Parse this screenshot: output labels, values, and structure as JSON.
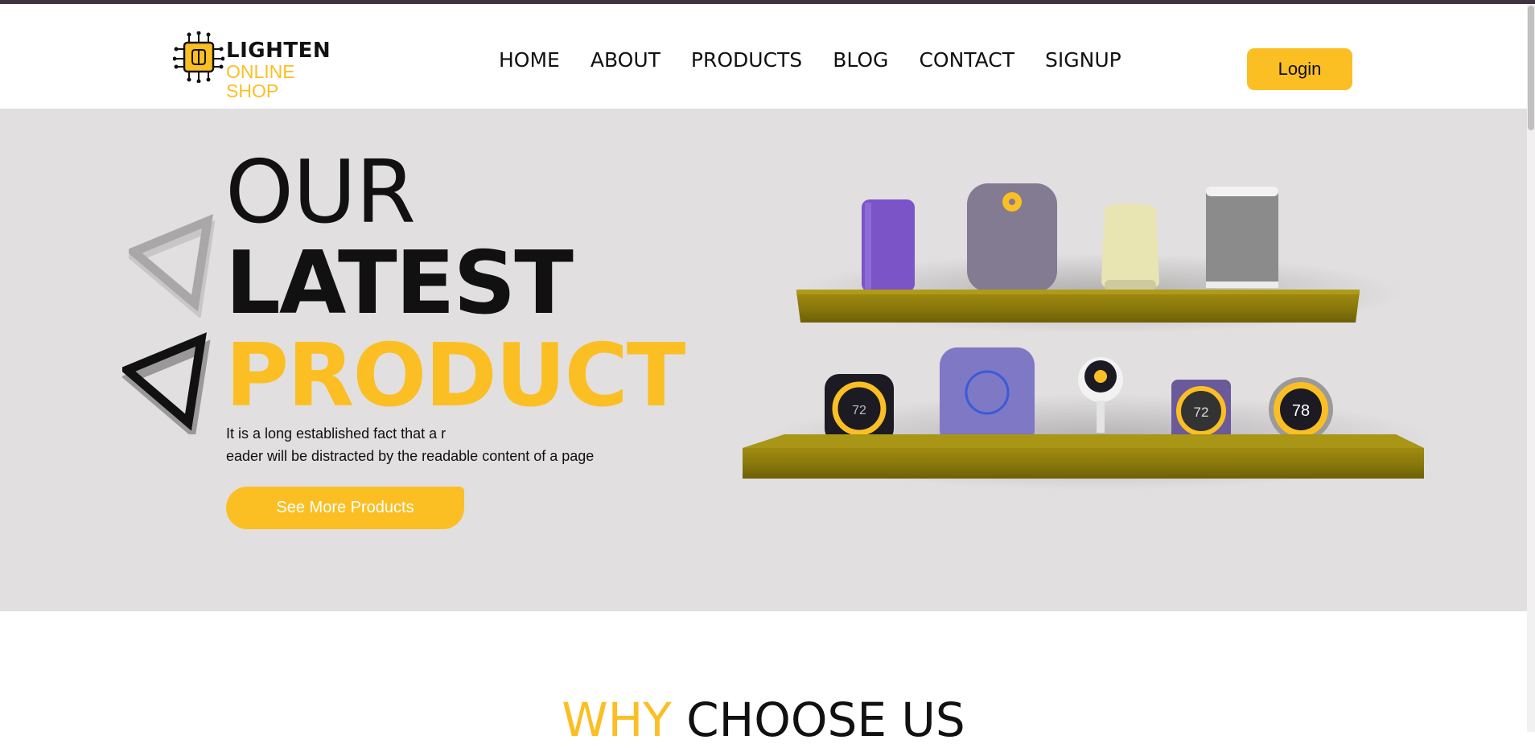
{
  "brand": {
    "title": "LIGHTEN",
    "subtitle": "ONLINE SHOP"
  },
  "nav": {
    "items": [
      "HOME",
      "ABOUT",
      "PRODUCTS",
      "BLOG",
      "CONTACT",
      "SIGNUP"
    ]
  },
  "header": {
    "login_label": "Login"
  },
  "hero": {
    "line1": "OUR",
    "line2": "LATEST",
    "line3": "PRODUCT",
    "text_line1": "It is a long established fact that a r",
    "text_line2": "eader will be distracted by the readable content of a page",
    "cta_label": "See More Products",
    "device_readouts": [
      "72",
      "72",
      "78"
    ]
  },
  "why": {
    "word1": "WHY",
    "word2": "CHOOSE US"
  },
  "colors": {
    "accent": "#fbbf24",
    "hero_bg": "#e1dfe0",
    "text": "#111111",
    "topbar": "#3d3540"
  }
}
